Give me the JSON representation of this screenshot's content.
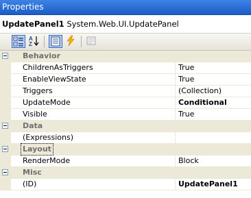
{
  "window": {
    "title": "Properties"
  },
  "object_selector": {
    "name": "UpdatePanel1",
    "type": "System.Web.UI.UpdatePanel"
  },
  "toolbar": {
    "buttons": [
      {
        "name": "categorized-button",
        "icon": "categorized-icon",
        "active": true
      },
      {
        "name": "alphabetical-button",
        "icon": "sort-az-icon",
        "active": false
      },
      {
        "name": "properties-button",
        "icon": "properties-list-icon",
        "active": true
      },
      {
        "name": "events-button",
        "icon": "lightning-icon",
        "active": false
      },
      {
        "name": "property-pages-button",
        "icon": "property-pages-icon",
        "active": false
      }
    ]
  },
  "categories": [
    {
      "label": "Behavior",
      "rows": [
        {
          "name": "ChildrenAsTriggers",
          "value": "True",
          "bold": false
        },
        {
          "name": "EnableViewState",
          "value": "True",
          "bold": false
        },
        {
          "name": "Triggers",
          "value": "(Collection)",
          "bold": false
        },
        {
          "name": "UpdateMode",
          "value": "Conditional",
          "bold": true
        },
        {
          "name": "Visible",
          "value": "True",
          "bold": false
        }
      ]
    },
    {
      "label": "Data",
      "rows": [
        {
          "name": "(Expressions)",
          "value": "",
          "bold": false
        }
      ]
    },
    {
      "label": "Layout",
      "focused": true,
      "rows": [
        {
          "name": "RenderMode",
          "value": "Block",
          "bold": false
        }
      ]
    },
    {
      "label": "Misc",
      "rows": [
        {
          "name": "(ID)",
          "value": "UpdatePanel1",
          "bold": true
        }
      ]
    }
  ]
}
